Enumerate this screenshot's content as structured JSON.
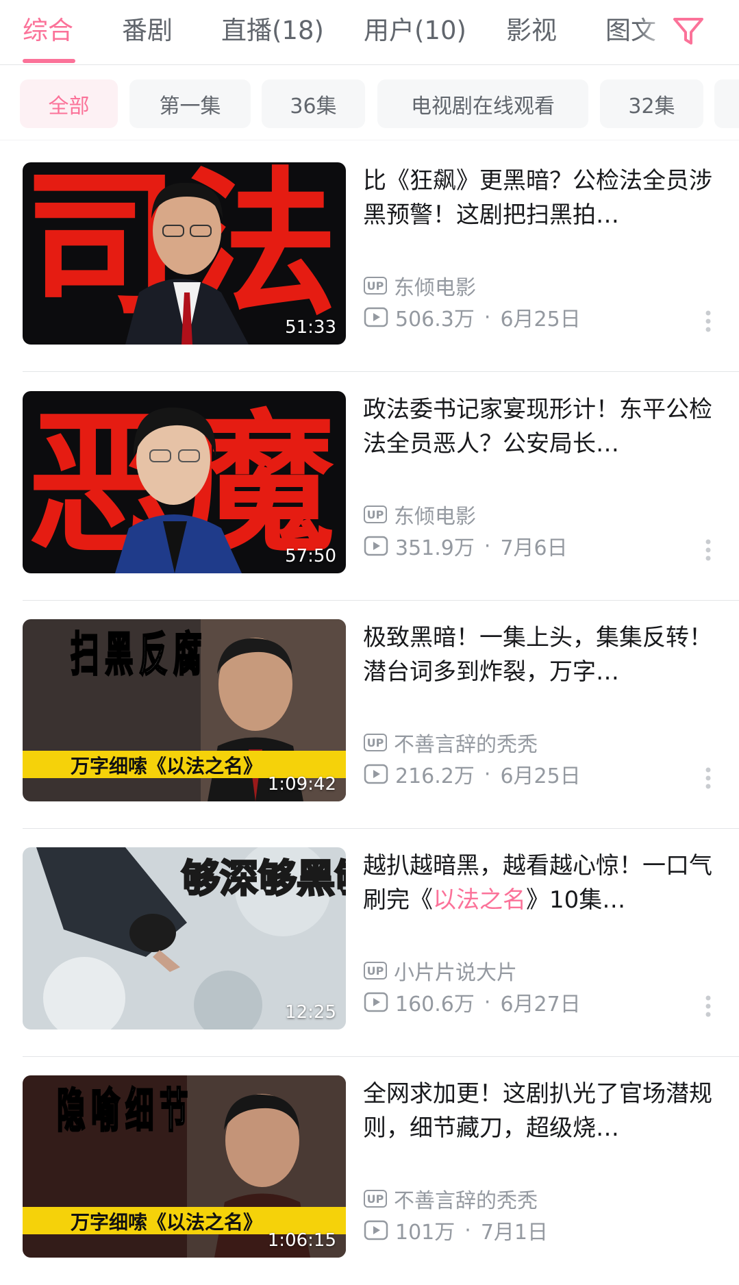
{
  "tabs": [
    {
      "label": "综合",
      "active": true
    },
    {
      "label": "番剧"
    },
    {
      "label": "直播(18)"
    },
    {
      "label": "用户(10)"
    },
    {
      "label": "影视"
    },
    {
      "label": "图文"
    }
  ],
  "filter_icon": "filter-funnel-icon",
  "chips": [
    {
      "label": "全部",
      "active": true
    },
    {
      "label": "第一集"
    },
    {
      "label": "36集"
    },
    {
      "label": "电视剧在线观看"
    },
    {
      "label": "32集"
    }
  ],
  "colors": {
    "accent": "#fb7299",
    "meta": "#9499a0",
    "text": "#18191c"
  },
  "results": [
    {
      "title": "比《狂飙》更黑暗？公检法全员涉黑预警！这剧把扫黑拍…",
      "uploader": "东倾电影",
      "views": "506.3万",
      "date": "6月25日",
      "duration": "51:33",
      "thumb_text": "司法"
    },
    {
      "title": "政法委书记家宴现形计！东平公检法全员恶人？公安局长…",
      "uploader": "东倾电影",
      "views": "351.9万",
      "date": "7月6日",
      "duration": "57:50",
      "thumb_text": "恶魔"
    },
    {
      "title": "极致黑暗！一集上头，集集反转！潜台词多到炸裂，万字…",
      "uploader": "不善言辞的秃秃",
      "views": "216.2万",
      "date": "6月25日",
      "duration": "1:09:42",
      "thumb_text": "扫黑反腐",
      "thumb_banner": "万字细嗦《以法之名》"
    },
    {
      "title_pre": "越扒越暗黑，越看越心惊！一口气刷完《",
      "title_hl": "以法之名",
      "title_post": "》10集…",
      "uploader": "小片片说大片",
      "views": "160.6万",
      "date": "6月27日",
      "duration": "12:25",
      "thumb_text": "够深够黑够烧脑"
    },
    {
      "title": "全网求加更！这剧扒光了官场潜规则，细节藏刀，超级烧…",
      "uploader": "不善言辞的秃秃",
      "views": "101万",
      "date": "7月1日",
      "duration": "1:06:15",
      "thumb_text": "隐喻细节",
      "thumb_banner": "万字细嗦《以法之名》"
    }
  ],
  "up_badge": "UP"
}
